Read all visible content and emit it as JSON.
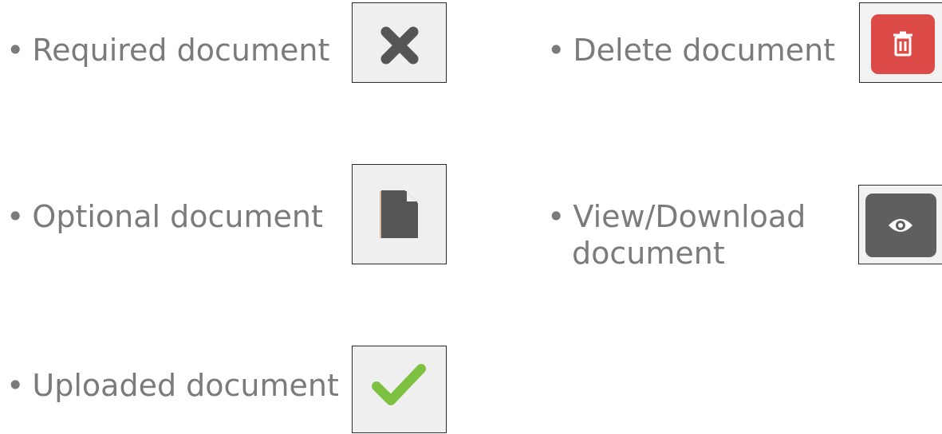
{
  "legend": {
    "bullet": "•",
    "required": {
      "label": "Required document",
      "icon": "x-icon"
    },
    "optional": {
      "label": "Optional document",
      "icon": "document-icon"
    },
    "uploaded": {
      "label": "Uploaded document",
      "icon": "checkmark-icon"
    },
    "delete": {
      "label": "Delete document",
      "icon": "trash-icon"
    },
    "view": {
      "label_line1": "View/Download",
      "label_line2": "document",
      "icon": "eye-icon"
    }
  },
  "colors": {
    "text": "#7b7b7b",
    "icon_box_bg": "#efefef",
    "x_icon": "#555555",
    "document_icon": "#555555",
    "check_icon": "#7dc142",
    "delete_button": "#dc4b47",
    "view_button": "#5f5f5f"
  }
}
